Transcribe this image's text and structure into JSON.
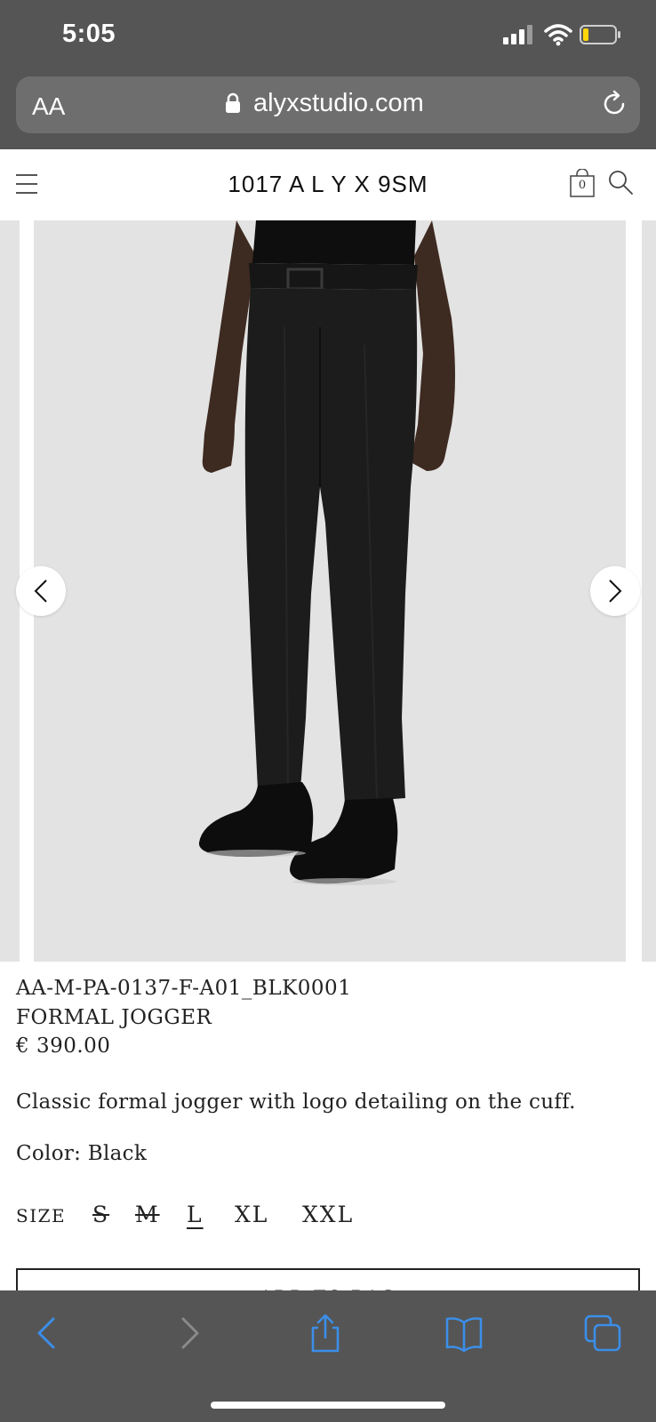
{
  "status_bar": {
    "time": "5:05",
    "icons": [
      "signal-icon",
      "wifi-icon",
      "battery-icon"
    ]
  },
  "browser": {
    "text_size_button": "AA",
    "url": "alyxstudio.com",
    "icons": [
      "lock-icon",
      "reload-icon"
    ]
  },
  "header": {
    "logo": "1017 A L Y X 9SM",
    "bag_count": "0",
    "icons": [
      "menu-icon",
      "shopping-bag-icon",
      "search-icon"
    ]
  },
  "carousel": {
    "prev_icon": "chevron-left-icon",
    "next_icon": "chevron-right-icon"
  },
  "product": {
    "sku": "AA-M-PA-0137-F-A01_BLK0001",
    "name": "FORMAL JOGGER",
    "price": "€ 390.00",
    "description": "Classic formal jogger with logo detailing on the cuff.",
    "color": "Color: Black",
    "size_label": "SIZE",
    "sizes": [
      {
        "label": "S",
        "status": "unavailable"
      },
      {
        "label": "M",
        "status": "unavailable"
      },
      {
        "label": "L",
        "status": "selected"
      },
      {
        "label": "XL",
        "status": "available"
      },
      {
        "label": "XXL",
        "status": "available"
      }
    ],
    "add_to_bag": "ADD TO BAG"
  },
  "toolbar": {
    "icons": [
      "back-icon",
      "forward-icon",
      "share-icon",
      "bookmarks-icon",
      "tabs-icon"
    ]
  },
  "colors": {
    "browser_chrome": "#555555",
    "url_bar": "#6e6e6e",
    "image_background": "#e3e3e3",
    "toolbar_accent": "#3b8ee8"
  }
}
